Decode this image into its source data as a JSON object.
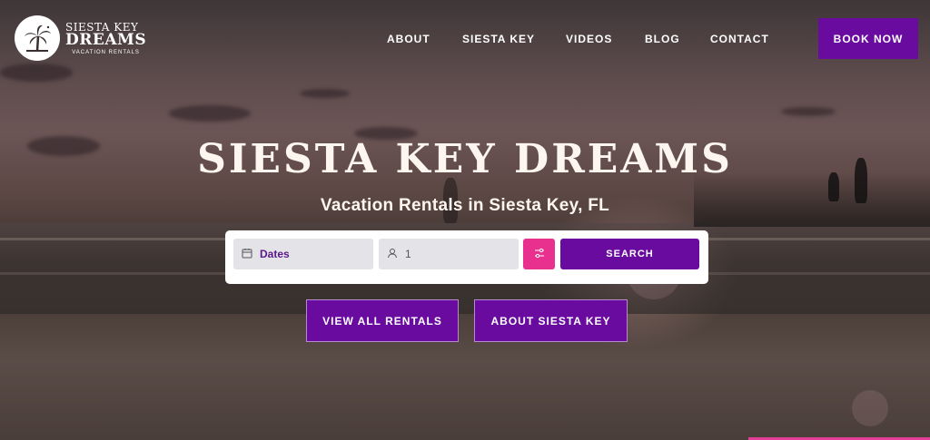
{
  "logo": {
    "line1": "SIESTA KEY",
    "line2": "DREAMS",
    "line3": "VACATION RENTALS"
  },
  "nav": {
    "items": [
      "ABOUT",
      "SIESTA KEY",
      "VIDEOS",
      "BLOG",
      "CONTACT"
    ]
  },
  "header": {
    "book_label": "BOOK NOW"
  },
  "hero": {
    "title": "SIESTA KEY DREAMS",
    "subtitle": "Vacation Rentals in Siesta Key, FL"
  },
  "search": {
    "dates_label": "Dates",
    "guests_value": "1",
    "search_label": "SEARCH",
    "icons": {
      "dates": "calendar-icon",
      "guests": "user-icon",
      "filter": "sliders-icon"
    }
  },
  "cta": {
    "rentals_label": "VIEW ALL RENTALS",
    "about_label": "ABOUT SIESTA KEY"
  },
  "colors": {
    "brand_purple": "#6a0ba0",
    "accent_pink": "#e8318f",
    "field_gray": "#e4e3e7"
  }
}
